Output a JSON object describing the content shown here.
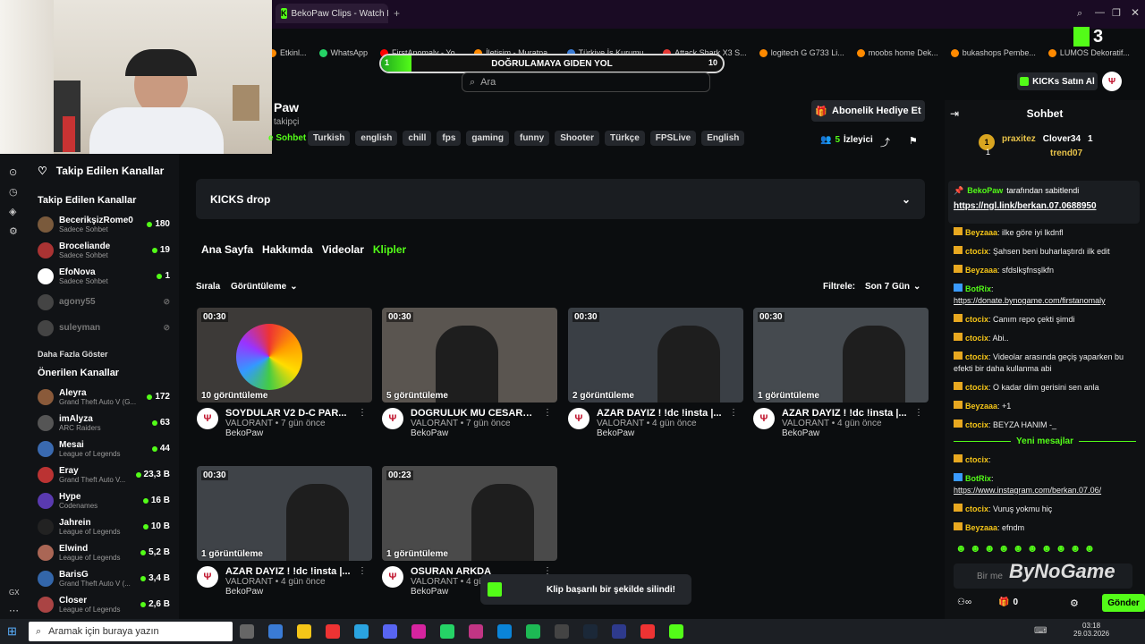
{
  "browser": {
    "tab_title": "BekoPaw Clips - Watch Li",
    "new_tab": "+"
  },
  "bookmarks": [
    {
      "label": "Etkinl...",
      "color": "#ff8a00"
    },
    {
      "label": "WhatsApp",
      "color": "#25d366"
    },
    {
      "label": "FirstAnomaly - Yo...",
      "color": "#ff0000"
    },
    {
      "label": "İletişim - Muratpa...",
      "color": "#ff8a00"
    },
    {
      "label": "Türkiye İş Kurumu...",
      "color": "#3a7bd5"
    },
    {
      "label": "Attack Shark X3 S...",
      "color": "#e53935"
    },
    {
      "label": "logitech G G733 Li...",
      "color": "#ff8a00"
    },
    {
      "label": "moobs home Dek...",
      "color": "#ff8a00"
    },
    {
      "label": "bukashops Pembe...",
      "color": "#ff8a00"
    },
    {
      "label": "LUMOS Dekoratif...",
      "color": "#ff8a00"
    }
  ],
  "progress": {
    "text": "DOĞRULAMAYA GIDEN YOL",
    "left": "1",
    "right": "10",
    "fraction": 0.09
  },
  "search": {
    "placeholder": "Ara"
  },
  "header": {
    "kicks_label": "KICKs Satın Al",
    "channel_name": "Paw",
    "followers": "takipçi",
    "subscribe": "Abonelik Hediye Et",
    "viewers": "5",
    "viewers_label": "İzleyici",
    "category": "e Sohbet"
  },
  "tags": [
    "Turkish",
    "english",
    "chill",
    "fps",
    "gaming",
    "funny",
    "Shooter",
    "Türkçe",
    "FPSLive",
    "English"
  ],
  "sidebar": {
    "followed_title": "Takip Edilen Kanallar",
    "followed_head": "Takip Edilen Kanallar",
    "followed": [
      {
        "name": "BecerikşizRome0",
        "sub": "Sadece Sohbet",
        "count": "180",
        "color": "#7a5a3c"
      },
      {
        "name": "Broceliande",
        "sub": "Sadece Sohbet",
        "count": "19",
        "color": "#a33"
      },
      {
        "name": "EfoNova",
        "sub": "Sadece Sohbet",
        "count": "1",
        "color": "#fff"
      },
      {
        "name": "agony55",
        "sub": "",
        "count": "",
        "color": "#444"
      },
      {
        "name": "suleyman",
        "sub": "",
        "count": "",
        "color": "#444"
      }
    ],
    "show_more": "Daha Fazla Göster",
    "suggested_head": "Önerilen Kanallar",
    "suggested": [
      {
        "name": "Aleyra",
        "sub": "Grand Theft Auto V (G...",
        "count": "172",
        "color": "#8a5a3a"
      },
      {
        "name": "imAlyza",
        "sub": "ARC Raiders",
        "count": "63",
        "color": "#555"
      },
      {
        "name": "Mesai",
        "sub": "League of Legends",
        "count": "44",
        "color": "#3a6ab0"
      },
      {
        "name": "Eray",
        "sub": "Grand Theft Auto V...",
        "count": "23,3 B",
        "color": "#b33"
      },
      {
        "name": "Hype",
        "sub": "Codenames",
        "count": "16 B",
        "color": "#5a3ab0"
      },
      {
        "name": "Jahrein",
        "sub": "League of Legends",
        "count": "10 B",
        "color": "#222"
      },
      {
        "name": "Elwind",
        "sub": "League of Legends",
        "count": "5,2 B",
        "color": "#a65"
      },
      {
        "name": "BarisG",
        "sub": "Grand Theft Auto V (...",
        "count": "3,4 B",
        "color": "#36a"
      },
      {
        "name": "Closer",
        "sub": "League of Legends",
        "count": "2,6 B",
        "color": "#a44"
      }
    ],
    "gx": "GX"
  },
  "kicks_drop": "KICKS drop",
  "tabs": [
    "Ana Sayfa",
    "Hakkımda",
    "Videolar",
    "Klipler"
  ],
  "sort": {
    "label": "Sırala",
    "value": "Görüntüleme",
    "filter_label": "Filtrele:",
    "filter_value": "Son 7 Gün"
  },
  "clips": [
    {
      "dur": "00:30",
      "views": "10 görüntüleme",
      "title": "SOYDULAR V2 D-C PAR...",
      "game": "VALORANT",
      "age": "7 gün önce",
      "channel": "BekoPaw"
    },
    {
      "dur": "00:30",
      "views": "5 görüntüleme",
      "title": "DOGRULUK MU CESARE...",
      "game": "VALORANT",
      "age": "7 gün önce",
      "channel": "BekoPaw"
    },
    {
      "dur": "00:30",
      "views": "2 görüntüleme",
      "title": "AZAR DAYIZ ! !dc !insta |...",
      "game": "VALORANT",
      "age": "4 gün önce",
      "channel": "BekoPaw"
    },
    {
      "dur": "00:30",
      "views": "1 görüntüleme",
      "title": "AZAR DAYIZ ! !dc !insta |...",
      "game": "VALORANT",
      "age": "4 gün önce",
      "channel": "BekoPaw"
    },
    {
      "dur": "00:30",
      "views": "1 görüntüleme",
      "title": "AZAR DAYIZ ! !dc !insta |...",
      "game": "VALORANT",
      "age": "4 gün önce",
      "channel": "BekoPaw"
    },
    {
      "dur": "00:23",
      "views": "1 görüntüleme",
      "title": "OSURAN ARKDA",
      "game": "VALORANT",
      "age": "4 gü",
      "channel": "BekoPaw"
    }
  ],
  "chat": {
    "title": "Sohbet",
    "top": [
      {
        "name": "praxitez",
        "count": "1"
      },
      {
        "name": "Clover34",
        "count": "1"
      },
      {
        "name": "trend07",
        "count": "1"
      }
    ],
    "pinned_by": "BekoPaw",
    "pinned_suffix": "tarafından sabitlendi",
    "pinned_link": "https://ngl.link/berkan.07.0688950",
    "messages": [
      {
        "user": "Beyzaaa",
        "color": "#f5c518",
        "text": "ilke göre iyi lkdnfl"
      },
      {
        "user": "ctocix",
        "color": "#f5c518",
        "text": "Şahsen beni buharlaştırdı ilk edit"
      },
      {
        "user": "Beyzaaa",
        "color": "#f5c518",
        "text": "sfdslkşfnsşlkfn"
      },
      {
        "user": "BotRix",
        "color": "#53fc18",
        "text": "https://donate.bynogame.com/firstanomaly"
      },
      {
        "user": "ctocix",
        "color": "#f5c518",
        "text": "Canım repo çekti şimdi"
      },
      {
        "user": "ctocix",
        "color": "#f5c518",
        "text": "Abi.."
      },
      {
        "user": "ctocix",
        "color": "#f5c518",
        "text": "Videolar arasında geçiş yaparken bu efekti bir daha kullanma abi"
      },
      {
        "user": "ctocix",
        "color": "#f5c518",
        "text": "O kadar diim gerisini sen anla"
      },
      {
        "user": "Beyzaaa",
        "color": "#f5c518",
        "text": "+1"
      },
      {
        "user": "ctocix",
        "color": "#f5c518",
        "text": "BEYZA HANIM -_"
      }
    ],
    "new_label": "Yeni mesajlar",
    "new_messages": [
      {
        "user": "ctocix",
        "color": "#f5c518",
        "text": ""
      },
      {
        "user": "BotRix",
        "color": "#53fc18",
        "text": "https://www.instagram.com/berkan.07.06/"
      },
      {
        "user": "ctocix",
        "color": "#f5c518",
        "text": "Vuruş yokmu hiç"
      },
      {
        "user": "Beyzaaa",
        "color": "#f5c518",
        "text": "efndm"
      }
    ],
    "input_placeholder": "Bir me",
    "send": "Gönder",
    "points": "0",
    "watermark": "ByNoGame"
  },
  "toast": "Klip başarılı bir şekilde silindi!",
  "taskbar": {
    "search": "Aramak için buraya yazın",
    "time": "03:18",
    "date": "29.03.2026"
  }
}
